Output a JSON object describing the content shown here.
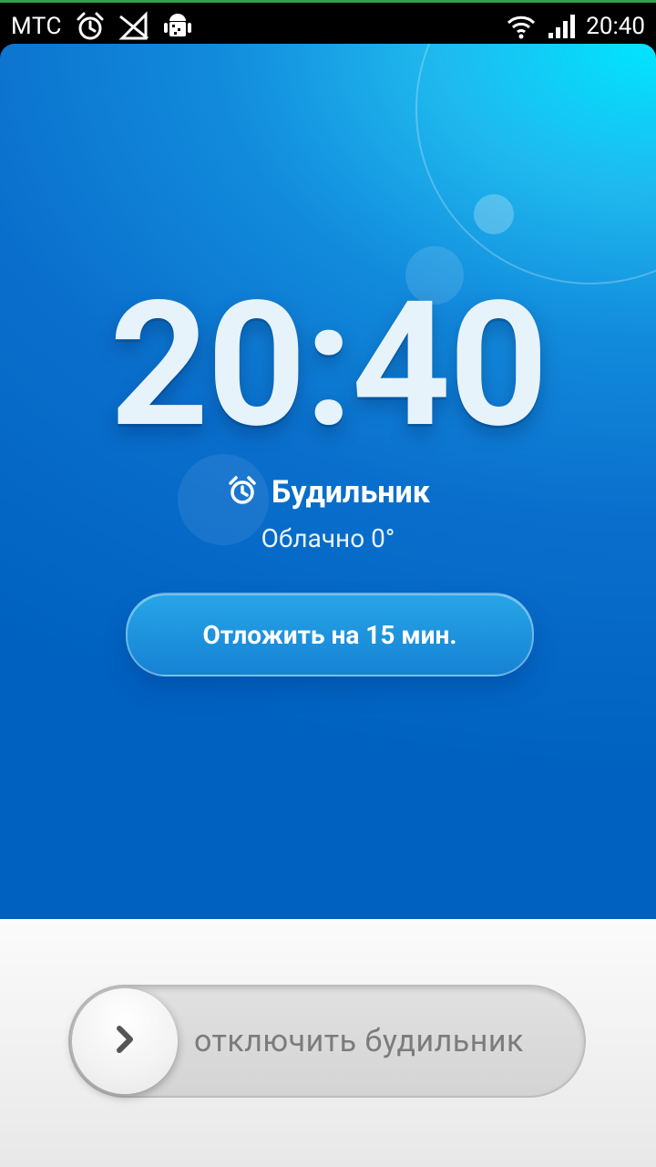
{
  "status_bar": {
    "carrier": "МТС",
    "time": "20:40",
    "icons": [
      "alarm-icon",
      "no-sim-icon",
      "android-debug-icon",
      "wifi-icon",
      "signal-icon"
    ]
  },
  "alarm": {
    "time": "20:40",
    "label": "Будильник",
    "weather": "Облачно 0°",
    "snooze_label": "Отложить на 15 мин."
  },
  "dismiss": {
    "label": "отключить будильник"
  },
  "colors": {
    "status_bar_bg": "#000000",
    "blue_dark": "#0061c0",
    "blue_light": "#00e5ff",
    "white_bg": "#fbfbfb"
  }
}
